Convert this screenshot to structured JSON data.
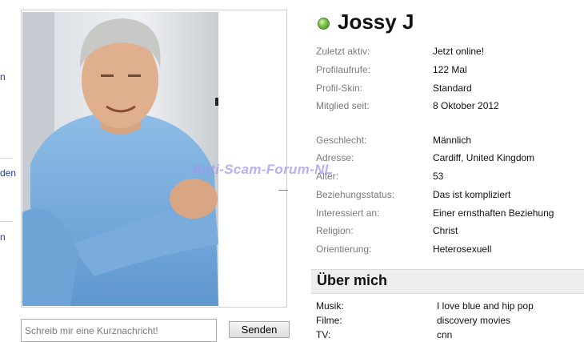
{
  "sidebar": {
    "fragments": [
      "n",
      "den",
      "n"
    ]
  },
  "photo": {
    "icon": "portrait-photo"
  },
  "message": {
    "placeholder": "Schreib mir eine Kurznachricht!",
    "send_label": "Senden"
  },
  "profile": {
    "name": "Jossy J",
    "status_color": "#6dbb3f",
    "info": [
      {
        "label": "Zuletzt aktiv:",
        "value": "Jetzt online!"
      },
      {
        "label": "Profilaufrufe:",
        "value": "122 Mal"
      },
      {
        "label": "Profil-Skin:",
        "value": "Standard"
      },
      {
        "label": "Mitglied seit:",
        "value": "8 Oktober 2012"
      },
      {
        "label": "Geschlecht:",
        "value": "Männlich"
      },
      {
        "label": "Adresse:",
        "value": "Cardiff, United Kingdom"
      },
      {
        "label": "Alter:",
        "value": "53"
      },
      {
        "label": "Beziehungsstatus:",
        "value": "Das ist kompliziert"
      },
      {
        "label": "Interessiert an:",
        "value": "Einer ernsthaften Beziehung"
      },
      {
        "label": "Religion:",
        "value": "Christ"
      },
      {
        "label": "Orientierung:",
        "value": "Heterosexuell"
      }
    ]
  },
  "about": {
    "title": "Über mich",
    "items": [
      {
        "label": "Musik:",
        "value": "I love blue and hip pop"
      },
      {
        "label": "Filme:",
        "value": "discovery movies"
      },
      {
        "label": "TV:",
        "value": "cnn"
      }
    ]
  },
  "watermark": "Anti-Scam-Forum-NL"
}
